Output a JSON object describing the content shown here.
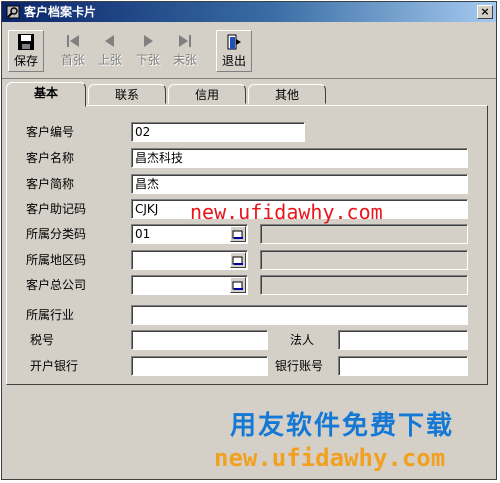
{
  "window": {
    "title": "客户档案卡片",
    "close_glyph": "×"
  },
  "toolbar": {
    "buttons": [
      {
        "label": "保存",
        "icon": "save-icon",
        "enabled": true
      },
      {
        "label": "首张",
        "icon": "first-icon",
        "enabled": false
      },
      {
        "label": "上张",
        "icon": "prev-icon",
        "enabled": false
      },
      {
        "label": "下张",
        "icon": "next-icon",
        "enabled": false
      },
      {
        "label": "末张",
        "icon": "last-icon",
        "enabled": false
      },
      {
        "label": "退出",
        "icon": "exit-icon",
        "enabled": true
      }
    ]
  },
  "tabs": [
    {
      "label": "基本",
      "active": true
    },
    {
      "label": "联系",
      "active": false
    },
    {
      "label": "信用",
      "active": false
    },
    {
      "label": "其他",
      "active": false
    }
  ],
  "form": {
    "customer_code": {
      "label": "客户编号",
      "value": "02"
    },
    "customer_name": {
      "label": "客户名称",
      "value": "昌杰科技"
    },
    "customer_short": {
      "label": "客户简称",
      "value": "昌杰"
    },
    "mnemonic": {
      "label": "客户助记码",
      "value": "CJKJ"
    },
    "category_code": {
      "label": "所属分类码",
      "value": "01"
    },
    "region_code": {
      "label": "所属地区码",
      "value": ""
    },
    "head_office": {
      "label": "客户总公司",
      "value": ""
    },
    "industry": {
      "label": "所属行业",
      "value": ""
    },
    "tax_no": {
      "label": "税号",
      "value": ""
    },
    "legal_person": {
      "label": "法人",
      "value": ""
    },
    "bank": {
      "label": "开户银行",
      "value": ""
    },
    "bank_account": {
      "label": "银行账号",
      "value": ""
    }
  },
  "watermarks": {
    "url_top": "new.ufidawhy.com",
    "slogan": "用友软件免费下载",
    "url_bottom": "new.ufidawhy.com"
  },
  "colors": {
    "titlebar": "#0a246a",
    "window_face": "#d4d0c8",
    "watermark_red": "#e8161a",
    "watermark_blue": "#1478d4",
    "watermark_orange": "#f2a020"
  }
}
